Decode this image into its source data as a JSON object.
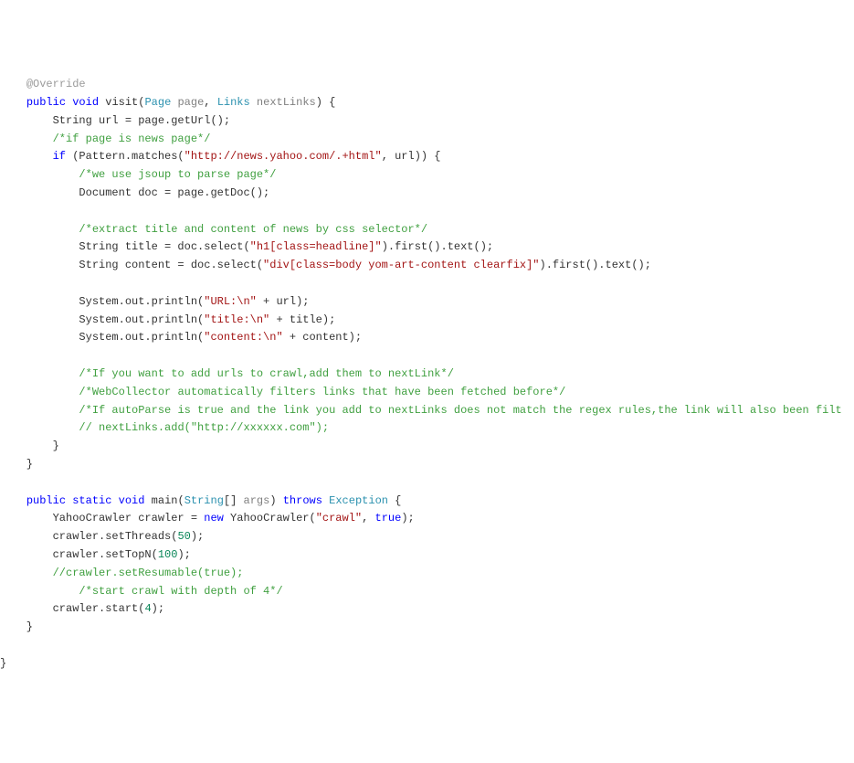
{
  "code": {
    "tokens": [
      [
        [
          "    ",
          "plain"
        ],
        [
          "@Override",
          "annotation"
        ]
      ],
      [
        [
          "    ",
          "plain"
        ],
        [
          "public",
          "keyword"
        ],
        [
          " ",
          "plain"
        ],
        [
          "void",
          "keyword"
        ],
        [
          " visit(",
          "plain"
        ],
        [
          "Page",
          "type"
        ],
        [
          " ",
          "plain"
        ],
        [
          "page",
          "param"
        ],
        [
          ", ",
          "plain"
        ],
        [
          "Links",
          "type"
        ],
        [
          " ",
          "plain"
        ],
        [
          "nextLinks",
          "param"
        ],
        [
          ") {",
          "plain"
        ]
      ],
      [
        [
          "        String url = page.getUrl();",
          "plain"
        ]
      ],
      [
        [
          "        ",
          "plain"
        ],
        [
          "/*if page is news page*/",
          "comment"
        ]
      ],
      [
        [
          "        ",
          "plain"
        ],
        [
          "if",
          "keyword"
        ],
        [
          " (Pattern.matches(",
          "plain"
        ],
        [
          "\"http://news.yahoo.com/.+html\"",
          "string"
        ],
        [
          ", url)) {",
          "plain"
        ]
      ],
      [
        [
          "            ",
          "plain"
        ],
        [
          "/*we use jsoup to parse page*/",
          "comment"
        ]
      ],
      [
        [
          "            Document doc = page.getDoc();",
          "plain"
        ]
      ],
      [
        [
          "",
          "plain"
        ]
      ],
      [
        [
          "            ",
          "plain"
        ],
        [
          "/*extract title and content of news by css selector*/",
          "comment"
        ]
      ],
      [
        [
          "            String title = doc.select(",
          "plain"
        ],
        [
          "\"h1[class=headline]\"",
          "string"
        ],
        [
          ").first().text();",
          "plain"
        ]
      ],
      [
        [
          "            String content = doc.select(",
          "plain"
        ],
        [
          "\"div[class=body yom-art-content clearfix]\"",
          "string"
        ],
        [
          ").first().text();",
          "plain"
        ]
      ],
      [
        [
          "",
          "plain"
        ]
      ],
      [
        [
          "            System.out.println(",
          "plain"
        ],
        [
          "\"URL:\\n\"",
          "string"
        ],
        [
          " + url);",
          "plain"
        ]
      ],
      [
        [
          "            System.out.println(",
          "plain"
        ],
        [
          "\"title:\\n\"",
          "string"
        ],
        [
          " + title);",
          "plain"
        ]
      ],
      [
        [
          "            System.out.println(",
          "plain"
        ],
        [
          "\"content:\\n\"",
          "string"
        ],
        [
          " + content);",
          "plain"
        ]
      ],
      [
        [
          "",
          "plain"
        ]
      ],
      [
        [
          "            ",
          "plain"
        ],
        [
          "/*If you want to add urls to crawl,add them to nextLink*/",
          "comment"
        ]
      ],
      [
        [
          "            ",
          "plain"
        ],
        [
          "/*WebCollector automatically filters links that have been fetched before*/",
          "comment"
        ]
      ],
      [
        [
          "            ",
          "plain"
        ],
        [
          "/*If autoParse is true and the link you add to nextLinks does not match the regex rules,the link will also been filt",
          "comment"
        ]
      ],
      [
        [
          "            ",
          "plain"
        ],
        [
          "// nextLinks.add(\"http://xxxxxx.com\");",
          "comment"
        ]
      ],
      [
        [
          "        }",
          "plain"
        ]
      ],
      [
        [
          "    }",
          "plain"
        ]
      ],
      [
        [
          "",
          "plain"
        ]
      ],
      [
        [
          "    ",
          "plain"
        ],
        [
          "public",
          "keyword"
        ],
        [
          " ",
          "plain"
        ],
        [
          "static",
          "keyword"
        ],
        [
          " ",
          "plain"
        ],
        [
          "void",
          "keyword"
        ],
        [
          " main(",
          "plain"
        ],
        [
          "String",
          "type"
        ],
        [
          "[] ",
          "plain"
        ],
        [
          "args",
          "param"
        ],
        [
          ") ",
          "plain"
        ],
        [
          "throws",
          "keyword"
        ],
        [
          " ",
          "plain"
        ],
        [
          "Exception",
          "type"
        ],
        [
          " {",
          "plain"
        ]
      ],
      [
        [
          "        YahooCrawler crawler = ",
          "plain"
        ],
        [
          "new",
          "keyword"
        ],
        [
          " YahooCrawler(",
          "plain"
        ],
        [
          "\"crawl\"",
          "string"
        ],
        [
          ", ",
          "plain"
        ],
        [
          "true",
          "keyword"
        ],
        [
          ");",
          "plain"
        ]
      ],
      [
        [
          "        crawler.setThreads(",
          "plain"
        ],
        [
          "50",
          "number"
        ],
        [
          ");",
          "plain"
        ]
      ],
      [
        [
          "        crawler.setTopN(",
          "plain"
        ],
        [
          "100",
          "number"
        ],
        [
          ");",
          "plain"
        ]
      ],
      [
        [
          "        ",
          "plain"
        ],
        [
          "//crawler.setResumable(true);",
          "comment"
        ]
      ],
      [
        [
          "            ",
          "plain"
        ],
        [
          "/*start crawl with depth of 4*/",
          "comment"
        ]
      ],
      [
        [
          "        crawler.start(",
          "plain"
        ],
        [
          "4",
          "number"
        ],
        [
          ");",
          "plain"
        ]
      ],
      [
        [
          "    }",
          "plain"
        ]
      ],
      [
        [
          "",
          "plain"
        ]
      ],
      [
        [
          "}",
          "plain"
        ]
      ]
    ]
  }
}
